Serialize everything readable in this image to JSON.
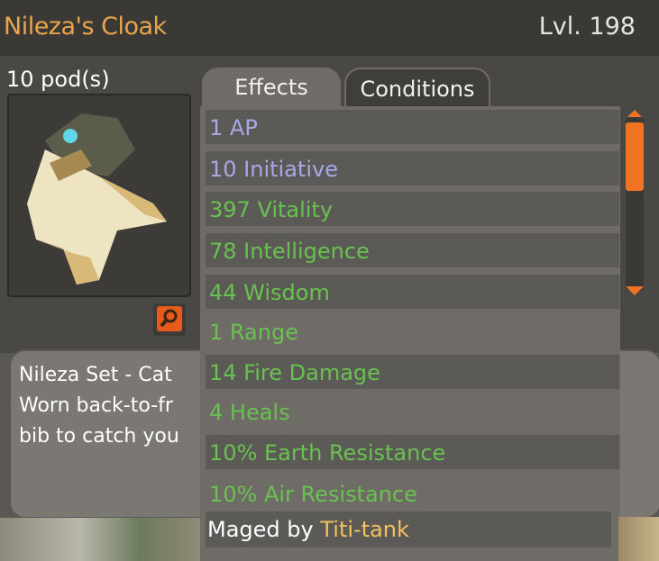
{
  "item": {
    "name": "Nileza's Cloak",
    "level": "Lvl. 198",
    "weight": "10 pod(s)"
  },
  "tabs": {
    "effects": "Effects",
    "conditions": "Conditions"
  },
  "description": {
    "line1": "Nileza Set - Cat",
    "line2": "Worn back-to-fr",
    "line3": "bib to catch you"
  },
  "effects": [
    {
      "text": "1 AP",
      "color": "#a6a9e6"
    },
    {
      "text": "10 Initiative",
      "color": "#a6a9e6"
    },
    {
      "text": "397 Vitality",
      "color": "#69c24f"
    },
    {
      "text": "78 Intelligence",
      "color": "#69c24f"
    },
    {
      "text": "44 Wisdom",
      "color": "#69c24f"
    },
    {
      "text": "1 Range",
      "color": "#69c24f"
    },
    {
      "text": "14 Fire Damage",
      "color": "#69c24f"
    },
    {
      "text": "4 Heals",
      "color": "#69c24f"
    },
    {
      "text": "10% Earth Resistance",
      "color": "#69c24f"
    },
    {
      "text": "10% Air Resistance",
      "color": "#69c24f"
    }
  ],
  "maged": {
    "label": "Maged by",
    "name": "Titi-tank"
  },
  "colors": {
    "accent": "#f07324",
    "title": "#e8a54b"
  }
}
